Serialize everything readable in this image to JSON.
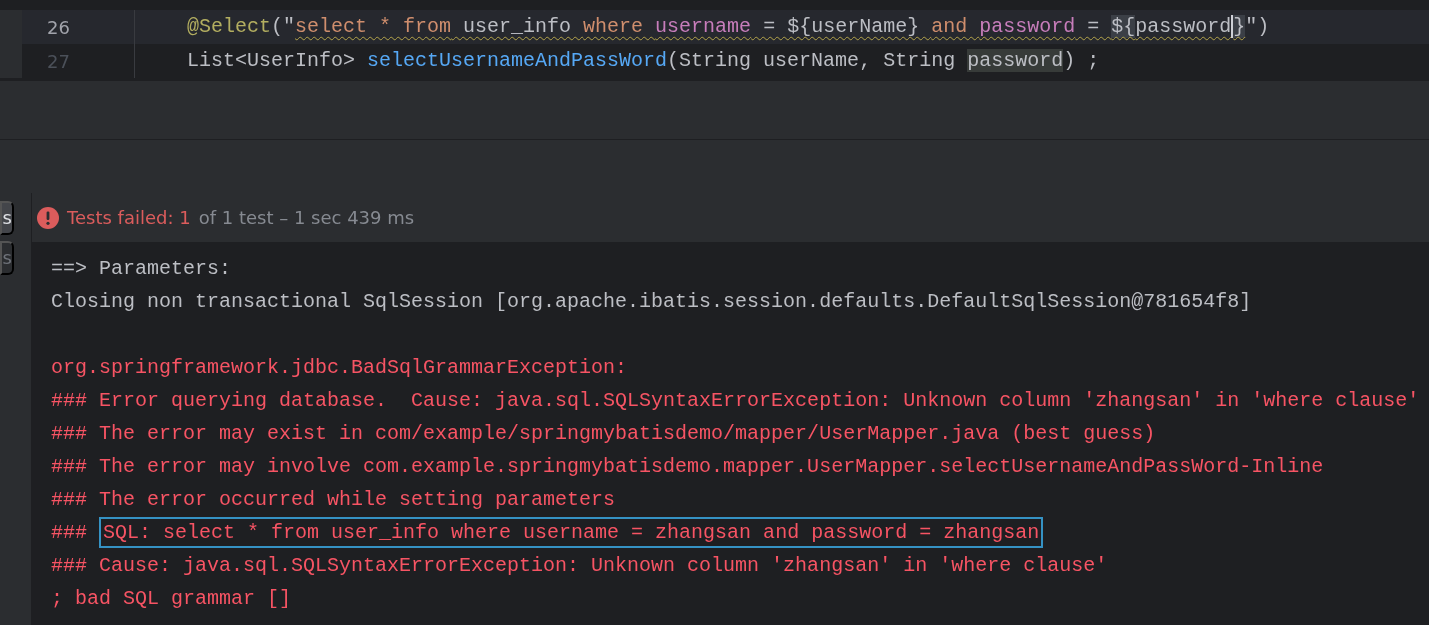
{
  "editor": {
    "lines": [
      {
        "number": "26",
        "current": true,
        "tokens": [
          {
            "text": "@Select",
            "kind": "annotation",
            "warned": false
          },
          {
            "text": "(\"",
            "kind": "plain",
            "warned": false
          },
          {
            "text": "select * from",
            "kind": "keyword",
            "warned": true
          },
          {
            "text": " user_info ",
            "kind": "plain",
            "warned": true
          },
          {
            "text": "where ",
            "kind": "keyword",
            "warned": true
          },
          {
            "text": "username",
            "kind": "column",
            "warned": true
          },
          {
            "text": " = ${userName} ",
            "kind": "plain",
            "warned": true
          },
          {
            "text": "and ",
            "kind": "keyword",
            "warned": true
          },
          {
            "text": "password",
            "kind": "column",
            "warned": true
          },
          {
            "text": " = ",
            "kind": "plain",
            "warned": true
          },
          {
            "text": "${",
            "kind": "brace",
            "warned": true
          },
          {
            "text": "password",
            "kind": "plain",
            "warned": true
          },
          {
            "text": "}",
            "kind": "brace-caret",
            "warned": true
          },
          {
            "text": "\")",
            "kind": "plain",
            "warned": false
          }
        ]
      },
      {
        "number": "27",
        "current": false,
        "tokens": [
          {
            "text": "List<UserInfo> ",
            "kind": "plain",
            "warned": false
          },
          {
            "text": "selectUsernameAndPassWord",
            "kind": "method",
            "warned": false
          },
          {
            "text": "(String userName, String ",
            "kind": "plain",
            "warned": false
          },
          {
            "text": "password",
            "kind": "usage",
            "warned": false
          },
          {
            "text": ") ;",
            "kind": "plain",
            "warned": false
          }
        ]
      }
    ]
  },
  "side_tabs": [
    {
      "label": "s",
      "selected": true
    },
    {
      "label": "s",
      "selected": false
    }
  ],
  "test_status": {
    "failed_label": "Tests failed: 1",
    "summary": "of 1 test – 1 sec 439 ms"
  },
  "console": [
    {
      "kind": "info",
      "text": "==> Parameters:"
    },
    {
      "kind": "info",
      "text": "Closing non transactional SqlSession [org.apache.ibatis.session.defaults.DefaultSqlSession@781654f8]"
    },
    {
      "kind": "blank"
    },
    {
      "kind": "error",
      "text": "org.springframework.jdbc.BadSqlGrammarException: "
    },
    {
      "kind": "error",
      "text": "### Error querying database.  Cause: java.sql.SQLSyntaxErrorException: Unknown column 'zhangsan' in 'where clause'"
    },
    {
      "kind": "error",
      "text": "### The error may exist in com/example/springmybatisdemo/mapper/UserMapper.java (best guess)"
    },
    {
      "kind": "error",
      "text": "### The error may involve com.example.springmybatisdemo.mapper.UserMapper.selectUsernameAndPassWord-Inline"
    },
    {
      "kind": "error",
      "text": "### The error occurred while setting parameters"
    },
    {
      "kind": "error",
      "text": "### ",
      "highlighted": "SQL: select * from user_info where username = zhangsan and password = zhangsan"
    },
    {
      "kind": "error",
      "text": "### Cause: java.sql.SQLSyntaxErrorException: Unknown column 'zhangsan' in 'where clause'"
    },
    {
      "kind": "error",
      "text": "; bad SQL grammar []"
    }
  ]
}
